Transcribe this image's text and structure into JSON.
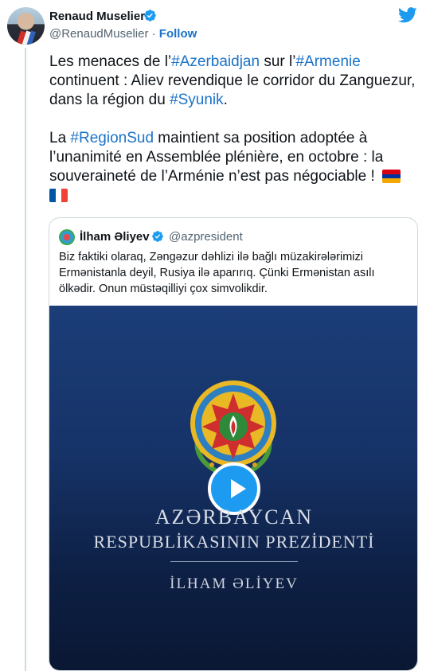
{
  "author": {
    "name": "Renaud Muselier",
    "handle": "@RenaudMuselier",
    "separator": " · ",
    "follow_label": "Follow"
  },
  "tweet": {
    "p1": {
      "t1": "Les menaces de l’",
      "h1": "#Azerbaidjan",
      "t2": " sur l’",
      "h2": "#Armenie",
      "t3": " continuent : Aliev revendique le corridor du Zanguezur, dans la région du ",
      "h3": "#Syunik",
      "t4": "."
    },
    "p2": {
      "t1": "La ",
      "h1": "#RegionSud",
      "t2": " maintient sa position adoptée à l’unanimité en Assemblée plénière, en octobre : la souveraineté de l’Arménie n’est pas négociable ! "
    }
  },
  "quote": {
    "name": "İlham Əliyev",
    "handle": "@azpresident",
    "text": "Biz faktiki olaraq, Zəngəzur dəhlizi ilə bağlı müzakirələrimizi Ermənistanla deyil, Rusiya ilə aparırıq. Çünki Ermənistan asılı ölkədir. Onun müstəqilliyi çox simvolikdir."
  },
  "media": {
    "line1": "AZƏRBAYCAN",
    "line2": "RESPUBLİKASININ PREZİDENTİ",
    "line3": "İLHAM ƏLİYEV"
  },
  "icons": {
    "verified": "verified-badge-icon",
    "twitter": "twitter-bird-icon",
    "play": "play-icon",
    "flag_armenia": "armenia-flag-icon",
    "flag_france": "france-flag-icon"
  },
  "colors": {
    "link": "#1b73c9",
    "twitter_blue": "#1d9bf0",
    "text": "#0f1419",
    "muted": "#536471",
    "media_bg": "#163368"
  }
}
